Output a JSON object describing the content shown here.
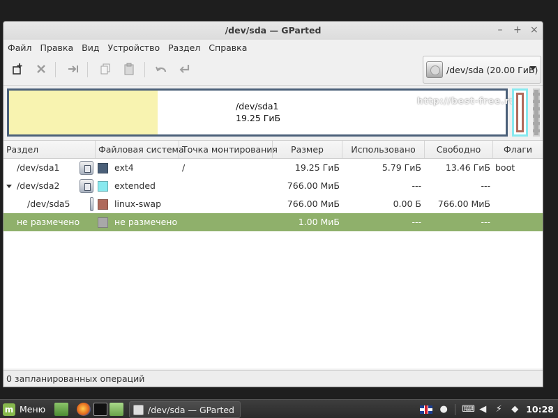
{
  "window": {
    "title": "/dev/sda — GParted"
  },
  "menu": [
    "Файл",
    "Правка",
    "Вид",
    "Устройство",
    "Раздел",
    "Справка"
  ],
  "toolbar": {
    "icons": [
      "new-partition-icon",
      "delete-icon",
      "resize-move-icon",
      "copy-icon",
      "paste-icon",
      "undo-icon",
      "apply-icon"
    ]
  },
  "device_selector": {
    "label": "/dev/sda  (20.00 ГиБ)"
  },
  "disk_map": {
    "partition_name": "/dev/sda1",
    "partition_size": "19.25 ГиБ",
    "watermark": "http://best-free.ru",
    "used_fraction": 0.3
  },
  "colors": {
    "ext4": "#4b6079",
    "extended": "#88e9ef",
    "linux_swap": "#b06a5c",
    "unallocated": "#a8a8a8",
    "selection": "#8fb06b",
    "used_space": "#f8f3b0"
  },
  "table": {
    "headers": [
      "Раздел",
      "Файловая система",
      "Точка монтирования",
      "Размер",
      "Использовано",
      "Свободно",
      "Флаги"
    ],
    "rows": [
      {
        "partition": "/dev/sda1",
        "fs": "ext4",
        "mount": "/",
        "size": "19.25 ГиБ",
        "used": "5.79 ГиБ",
        "free": "13.46 ГиБ",
        "flags": "boot"
      },
      {
        "partition": "/dev/sda2",
        "fs": "extended",
        "mount": "",
        "size": "766.00 МиБ",
        "used": "---",
        "free": "---",
        "flags": ""
      },
      {
        "partition": "/dev/sda5",
        "fs": "linux-swap",
        "mount": "",
        "size": "766.00 МиБ",
        "used": "0.00 Б",
        "free": "766.00 МиБ",
        "flags": ""
      },
      {
        "partition": "не размечено",
        "fs": "не размечено",
        "mount": "",
        "size": "1.00 МиБ",
        "used": "---",
        "free": "---",
        "flags": ""
      }
    ]
  },
  "status": "0 запланированных операций",
  "taskbar": {
    "menu_label": "Меню",
    "task_label": "/dev/sda — GParted",
    "clock": "10:28"
  }
}
